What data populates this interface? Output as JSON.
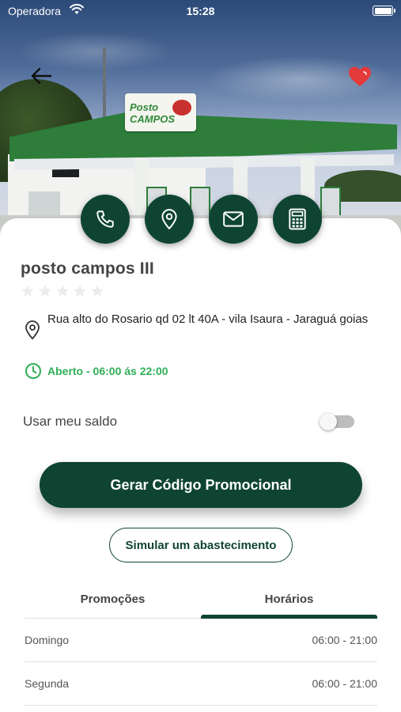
{
  "status_bar": {
    "carrier": "Operadora",
    "time": "15:28"
  },
  "header": {
    "back_icon": "arrow-left-icon",
    "favorite_icon": "heart-icon",
    "favorite_color": "#e53a3a"
  },
  "hero": {
    "sign_text": "Posto CAMPOS"
  },
  "actions": [
    {
      "name": "phone",
      "icon": "phone-icon"
    },
    {
      "name": "location",
      "icon": "map-pin-icon"
    },
    {
      "name": "email",
      "icon": "mail-icon"
    },
    {
      "name": "calculator",
      "icon": "calculator-icon"
    }
  ],
  "station": {
    "name": "posto campos III",
    "rating": 0,
    "rating_max": 5,
    "address": "Rua alto do Rosario qd 02 lt 40A - vila Isaura - Jaraguá goias",
    "hours_status": "Aberto - 06:00 ás 22:00"
  },
  "balance": {
    "label": "Usar meu saldo",
    "enabled": false
  },
  "buttons": {
    "generate_code": "Gerar Código Promocional",
    "simulate": "Simular um abastecimento"
  },
  "tabs": {
    "items": [
      "Promoções",
      "Horários"
    ],
    "active": "Horários"
  },
  "schedule": [
    {
      "day": "Domingo",
      "hours": "06:00 - 21:00"
    },
    {
      "day": "Segunda",
      "hours": "06:00 - 21:00"
    }
  ],
  "colors": {
    "primary": "#0f4433",
    "open_green": "#2fae56",
    "favorite": "#e53a3a"
  }
}
